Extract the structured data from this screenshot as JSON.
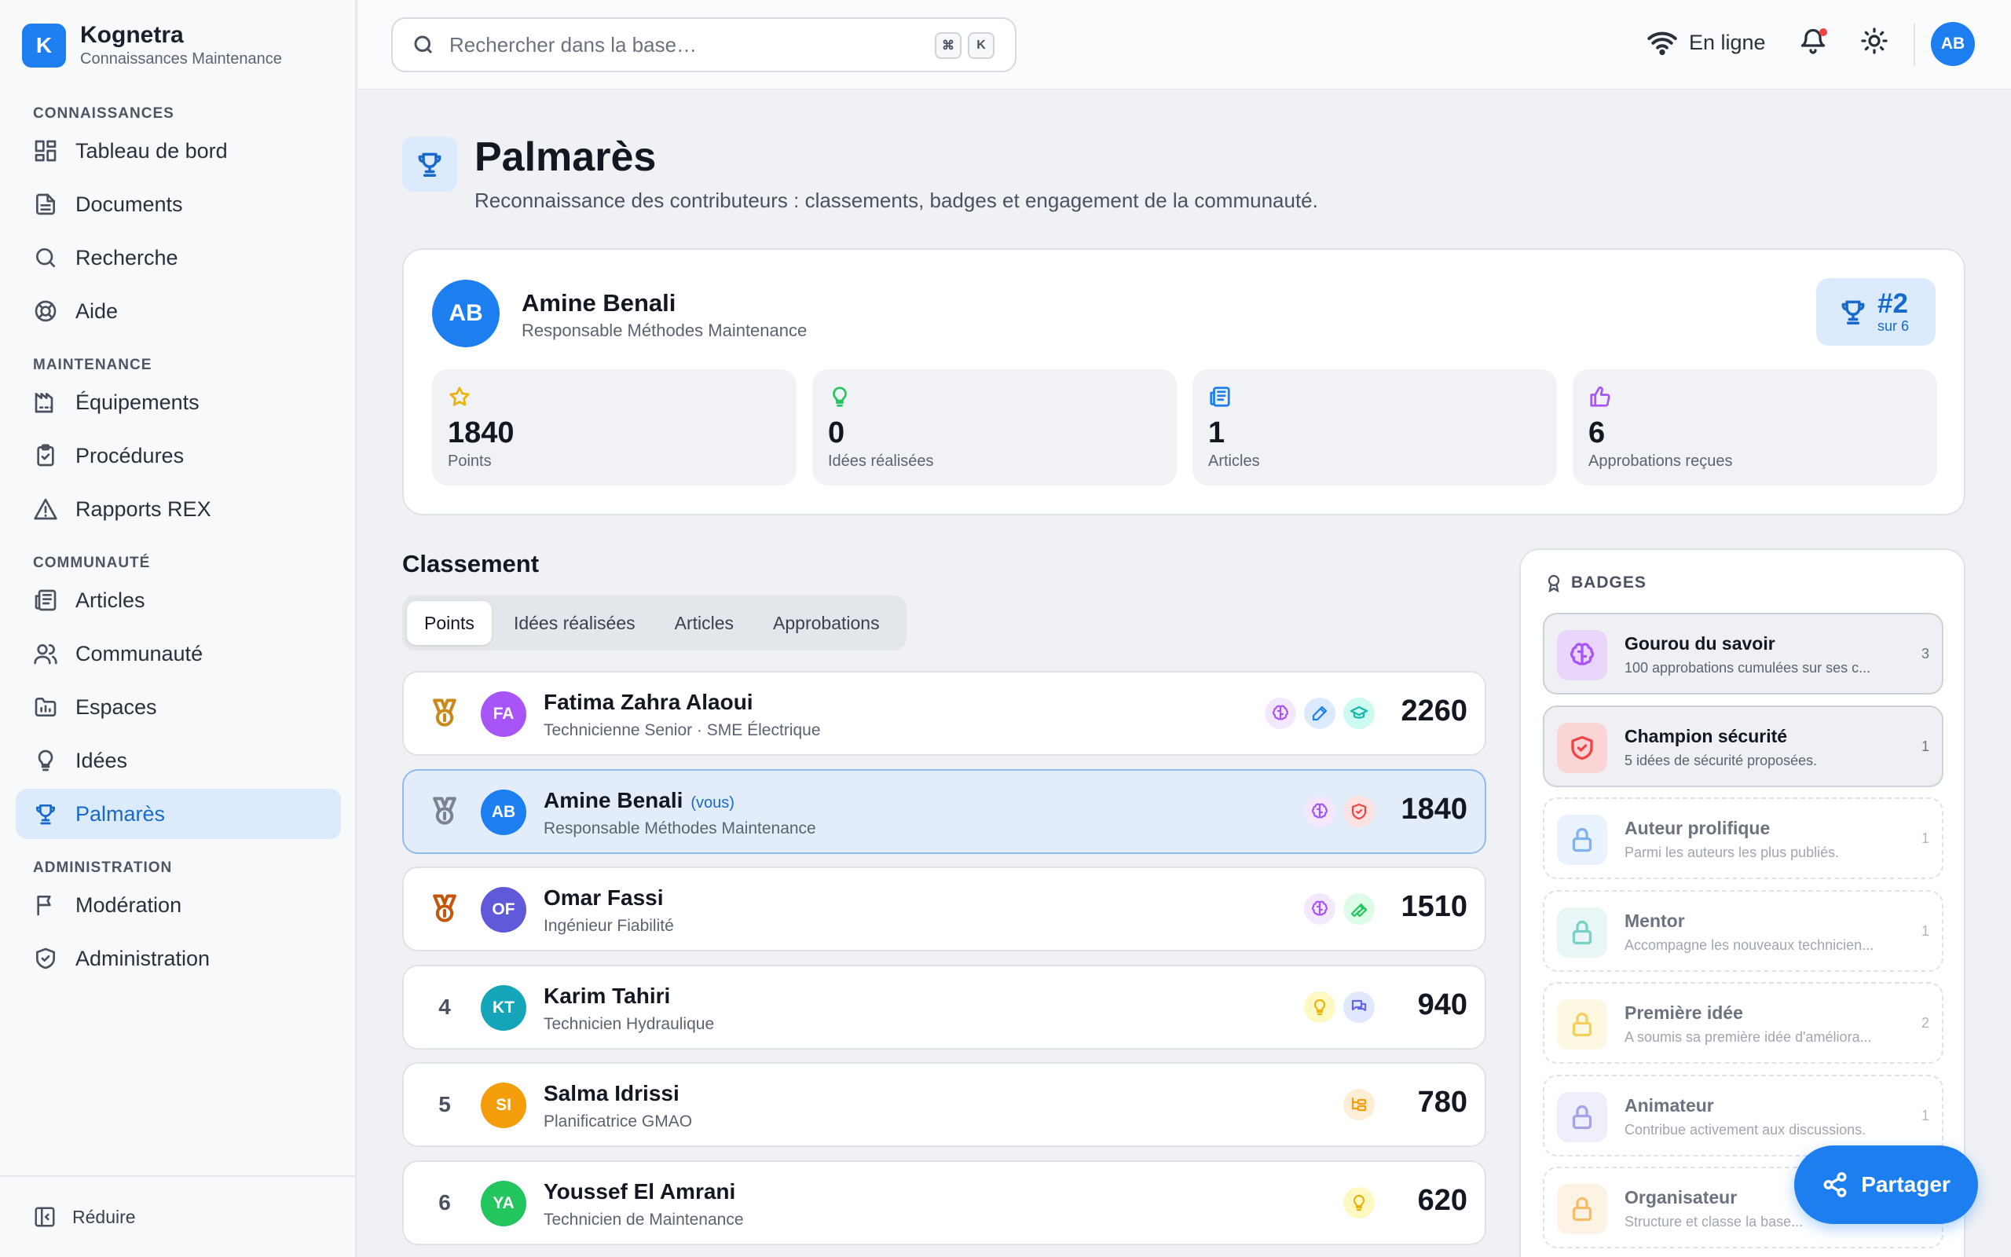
{
  "brand": {
    "name": "Kognetra",
    "subtitle": "Connaissances Maintenance",
    "logo_letter": "K"
  },
  "sidebar": {
    "sections": [
      {
        "title": "CONNAISSANCES",
        "items": [
          {
            "label": "Tableau de bord",
            "icon": "dashboard-icon"
          },
          {
            "label": "Documents",
            "icon": "document-icon"
          },
          {
            "label": "Recherche",
            "icon": "search-icon"
          },
          {
            "label": "Aide",
            "icon": "lifebuoy-icon"
          }
        ]
      },
      {
        "title": "MAINTENANCE",
        "items": [
          {
            "label": "Équipements",
            "icon": "factory-icon"
          },
          {
            "label": "Procédures",
            "icon": "clipboard-icon"
          },
          {
            "label": "Rapports REX",
            "icon": "warning-icon"
          }
        ]
      },
      {
        "title": "COMMUNAUTÉ",
        "items": [
          {
            "label": "Articles",
            "icon": "newspaper-icon"
          },
          {
            "label": "Communauté",
            "icon": "users-icon"
          },
          {
            "label": "Espaces",
            "icon": "folder-icon"
          },
          {
            "label": "Idées",
            "icon": "lightbulb-icon"
          },
          {
            "label": "Palmarès",
            "icon": "trophy-icon",
            "active": true
          }
        ]
      },
      {
        "title": "ADMINISTRATION",
        "items": [
          {
            "label": "Modération",
            "icon": "flag-icon"
          },
          {
            "label": "Administration",
            "icon": "shield-icon"
          }
        ]
      }
    ],
    "collapse_label": "Réduire"
  },
  "topbar": {
    "search_placeholder": "Rechercher dans la base…",
    "kbd": [
      "⌘",
      "K"
    ],
    "status": "En ligne",
    "avatar": "AB"
  },
  "page": {
    "title": "Palmarès",
    "subtitle": "Reconnaissance des contributeurs : classements, badges et engagement de la communauté."
  },
  "profile": {
    "initials": "AB",
    "name": "Amine Benali",
    "role": "Responsable Méthodes Maintenance",
    "rank": "#2",
    "rank_of": "sur 6",
    "stats": [
      {
        "value": "1840",
        "label": "Points",
        "icon": "star-icon",
        "color": "#eab308"
      },
      {
        "value": "0",
        "label": "Idées réalisées",
        "icon": "lightbulb-icon",
        "color": "#22c55e"
      },
      {
        "value": "1",
        "label": "Articles",
        "icon": "newspaper-icon",
        "color": "#1d7ef0"
      },
      {
        "value": "6",
        "label": "Approbations reçues",
        "icon": "thumbs-up-icon",
        "color": "#a855f7"
      }
    ]
  },
  "ranking": {
    "title": "Classement",
    "tabs": [
      "Points",
      "Idées réalisées",
      "Articles",
      "Approbations"
    ],
    "active_tab": 0,
    "rows": [
      {
        "rank": "1",
        "medal": "gold",
        "initials": "FA",
        "color": "#a855f7",
        "name": "Fatima Zahra Alaoui",
        "role": "Technicienne Senior · SME Électrique",
        "points": "2260",
        "you": false,
        "badges": [
          {
            "icon": "brain-icon",
            "color": "#a855f7",
            "bg": "#f3e8ff"
          },
          {
            "icon": "pen-icon",
            "color": "#1d7ef0",
            "bg": "#dbeafe"
          },
          {
            "icon": "graduation-cap-icon",
            "color": "#14b8a6",
            "bg": "#ccfbf1"
          }
        ]
      },
      {
        "rank": "2",
        "medal": "silver",
        "initials": "AB",
        "color": "#1d7ef0",
        "name": "Amine Benali",
        "you_label": "(vous)",
        "role": "Responsable Méthodes Maintenance",
        "points": "1840",
        "you": true,
        "badges": [
          {
            "icon": "brain-icon",
            "color": "#a855f7",
            "bg": "#f3e8ff"
          },
          {
            "icon": "shield-icon",
            "color": "#ef4444",
            "bg": "#fee2e2"
          }
        ]
      },
      {
        "rank": "3",
        "medal": "bronze",
        "initials": "OF",
        "color": "#6059d9",
        "name": "Omar Fassi",
        "role": "Ingénieur Fiabilité",
        "points": "1510",
        "you": false,
        "badges": [
          {
            "icon": "brain-icon",
            "color": "#a855f7",
            "bg": "#f3e8ff"
          },
          {
            "icon": "wrench-icon",
            "color": "#22c55e",
            "bg": "#dcfce7"
          }
        ]
      },
      {
        "rank": "4",
        "initials": "KT",
        "color": "#14a5b8",
        "name": "Karim Tahiri",
        "role": "Technicien Hydraulique",
        "points": "940",
        "you": false,
        "badges": [
          {
            "icon": "lightbulb-icon",
            "color": "#eab308",
            "bg": "#fef9c3"
          },
          {
            "icon": "chat-icon",
            "color": "#6366f1",
            "bg": "#e0e7ff"
          }
        ]
      },
      {
        "rank": "5",
        "initials": "SI",
        "color": "#f59e0b",
        "name": "Salma Idrissi",
        "role": "Planificatrice GMAO",
        "points": "780",
        "you": false,
        "badges": [
          {
            "icon": "folder-tree-icon",
            "color": "#f59e0b",
            "bg": "#ffedd5"
          }
        ]
      },
      {
        "rank": "6",
        "initials": "YA",
        "color": "#22c55e",
        "name": "Youssef El Amrani",
        "role": "Technicien de Maintenance",
        "points": "620",
        "you": false,
        "badges": [
          {
            "icon": "lightbulb-icon",
            "color": "#eab308",
            "bg": "#fef9c3"
          }
        ]
      }
    ]
  },
  "badges": {
    "title": "BADGES",
    "items": [
      {
        "name": "Gourou du savoir",
        "desc": "100 approbations cumulées sur ses c...",
        "count": "3",
        "earned": true,
        "icon": "brain-icon",
        "color": "#a855f7",
        "bg": "#ead5fb"
      },
      {
        "name": "Champion sécurité",
        "desc": "5 idées de sécurité proposées.",
        "count": "1",
        "earned": true,
        "icon": "shield-icon",
        "color": "#ef4444",
        "bg": "#fbd5d5"
      },
      {
        "name": "Auteur prolifique",
        "desc": "Parmi les auteurs les plus publiés.",
        "count": "1",
        "earned": false,
        "icon": "lock-icon",
        "color": "#7fb2ee",
        "bg": "#eaf3fd"
      },
      {
        "name": "Mentor",
        "desc": "Accompagne les nouveaux technicien...",
        "count": "1",
        "earned": false,
        "icon": "lock-icon",
        "color": "#7ad0c8",
        "bg": "#e8f7f5"
      },
      {
        "name": "Première idée",
        "desc": "A soumis sa première idée d'améliora...",
        "count": "2",
        "earned": false,
        "icon": "lock-icon",
        "color": "#f3cf5e",
        "bg": "#fdf8e2"
      },
      {
        "name": "Animateur",
        "desc": "Contribue activement aux discussions.",
        "count": "1",
        "earned": false,
        "icon": "lock-icon",
        "color": "#a7a3e8",
        "bg": "#efeefb"
      },
      {
        "name": "Organisateur",
        "desc": "Structure et classe la base...",
        "count": "",
        "earned": false,
        "icon": "lock-icon",
        "color": "#f5bd6a",
        "bg": "#fdf3e4"
      }
    ]
  },
  "share_button": "Partager"
}
